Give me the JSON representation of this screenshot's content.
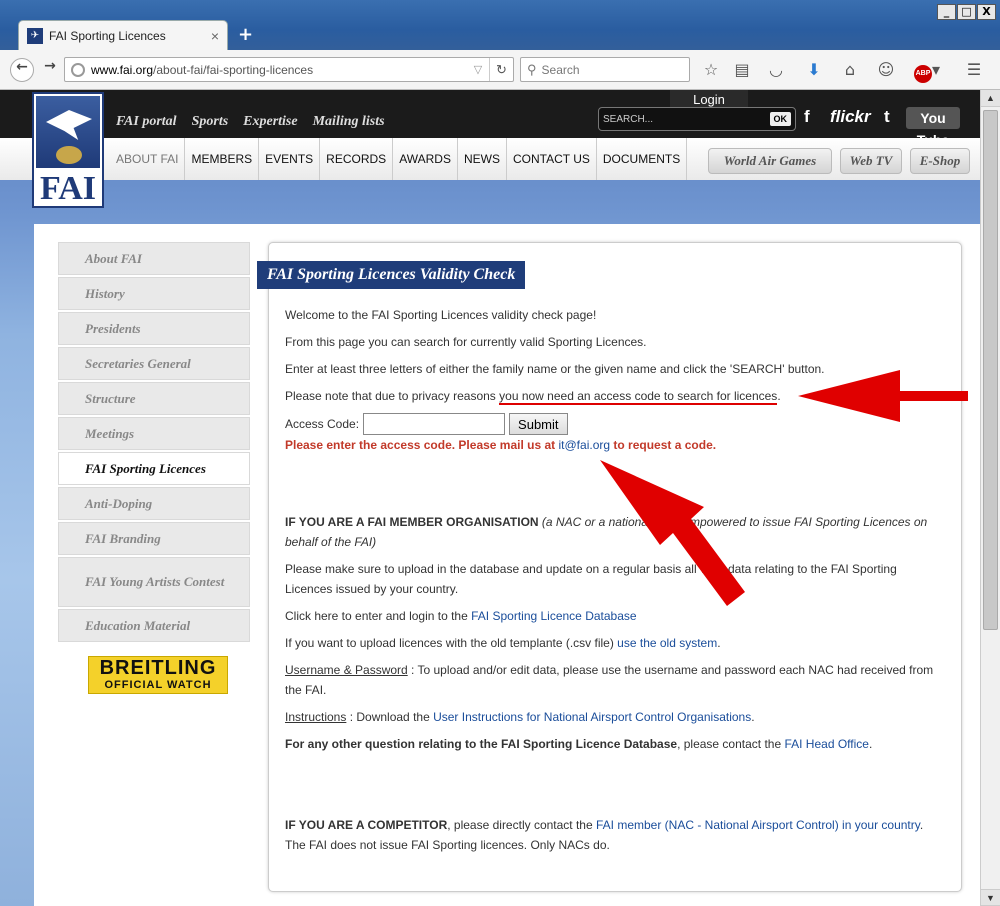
{
  "window": {
    "minimize": "_",
    "maximize": "□",
    "close": "X"
  },
  "tab": {
    "title": "FAI Sporting Licences",
    "close": "×",
    "new_tab": "+"
  },
  "nav": {
    "back": "←",
    "forward": "→",
    "url_host": "www.fai.org",
    "url_path": "/about-fai/fai-sporting-licences",
    "search_placeholder": "Search"
  },
  "toolbar_icons": [
    "star-icon",
    "reading-list-icon",
    "pocket-icon",
    "download-icon",
    "home-icon",
    "chat-icon",
    "adblock-icon",
    "menu-icon"
  ],
  "site": {
    "logo_text": "FAI",
    "top_nav": [
      "FAI portal",
      "Sports",
      "Expertise",
      "Mailing lists"
    ],
    "login_label": "Login",
    "search_placeholder": "SEARCH...",
    "search_ok": "OK",
    "social": {
      "facebook": "f",
      "flickr": "flickr",
      "twitter": "t",
      "youtube": "You Tube"
    },
    "main_nav": [
      "ABOUT FAI",
      "MEMBERS",
      "EVENTS",
      "RECORDS",
      "AWARDS",
      "NEWS",
      "CONTACT US",
      "DOCUMENTS"
    ],
    "pills": [
      "World Air Games",
      "Web TV",
      "E-Shop"
    ]
  },
  "sidebar": {
    "items": [
      "About FAI",
      "History",
      "Presidents",
      "Secretaries General",
      "Structure",
      "Meetings",
      "FAI Sporting Licences",
      "Anti-Doping",
      "FAI Branding",
      "FAI Young Artists Contest",
      "Education Material"
    ],
    "active_index": 6
  },
  "breitling": {
    "line1": "BREITLING",
    "line2": "OFFICIAL WATCH"
  },
  "panel": {
    "title": "FAI Sporting Licences Validity Check",
    "p1": "Welcome to the FAI Sporting Licences validity check page!",
    "p2": "From this page you can search for currently valid Sporting Licences.",
    "p3": "Enter at least three letters of either the family name or the given name and click the 'SEARCH' button.",
    "p4_a": "Please note that due to privacy reasons ",
    "p4_b": "you now need an access code to search for licences",
    "p4_c": ".",
    "access_label": "Access Code:",
    "submit_label": "Submit",
    "error_a": "Please enter the access code. Please mail us at ",
    "error_email": "it@fai.org",
    "error_b": " to request a code.",
    "member_heading": "IF YOU ARE A FAI MEMBER ORGANISATION",
    "member_italic": " (a NAC or a national body empowered to issue FAI Sporting Licences on behalf of the FAI)",
    "upload_text": "Please make sure to upload in the database and update on a regular basis all valid data relating to the FAI Sporting Licences issued by your country.",
    "click_here_a": "Click here to enter and login to the ",
    "click_here_link": "FAI Sporting Licence Database",
    "old_a": "If you want to upload licences with the old templante (.csv file) ",
    "old_link": "use the old system",
    "old_b": ".",
    "userpass_label": "Username & Password",
    "userpass_text": " : To upload and/or edit data, please use the username and password each NAC had received from the FAI.",
    "instr_label": "Instructions",
    "instr_a": " : Download the ",
    "instr_link": "User Instructions for National Airsport Control Organisations",
    "instr_b": ".",
    "other_bold": "For any other question relating to the FAI Sporting Licence Database",
    "other_a": ", please contact the ",
    "other_link": "FAI Head Office",
    "other_b": ".",
    "comp_heading": "IF YOU ARE A COMPETITOR",
    "comp_a": ", please directly contact the ",
    "comp_link": "FAI member (NAC - National Airsport Control) in your country",
    "comp_b": ". The FAI does not issue FAI Sporting licences. Only NACs do."
  },
  "colors": {
    "brand": "#1f3d7a",
    "error": "#c23a2a",
    "link": "#1a4d9a",
    "annotation": "#e00000"
  }
}
